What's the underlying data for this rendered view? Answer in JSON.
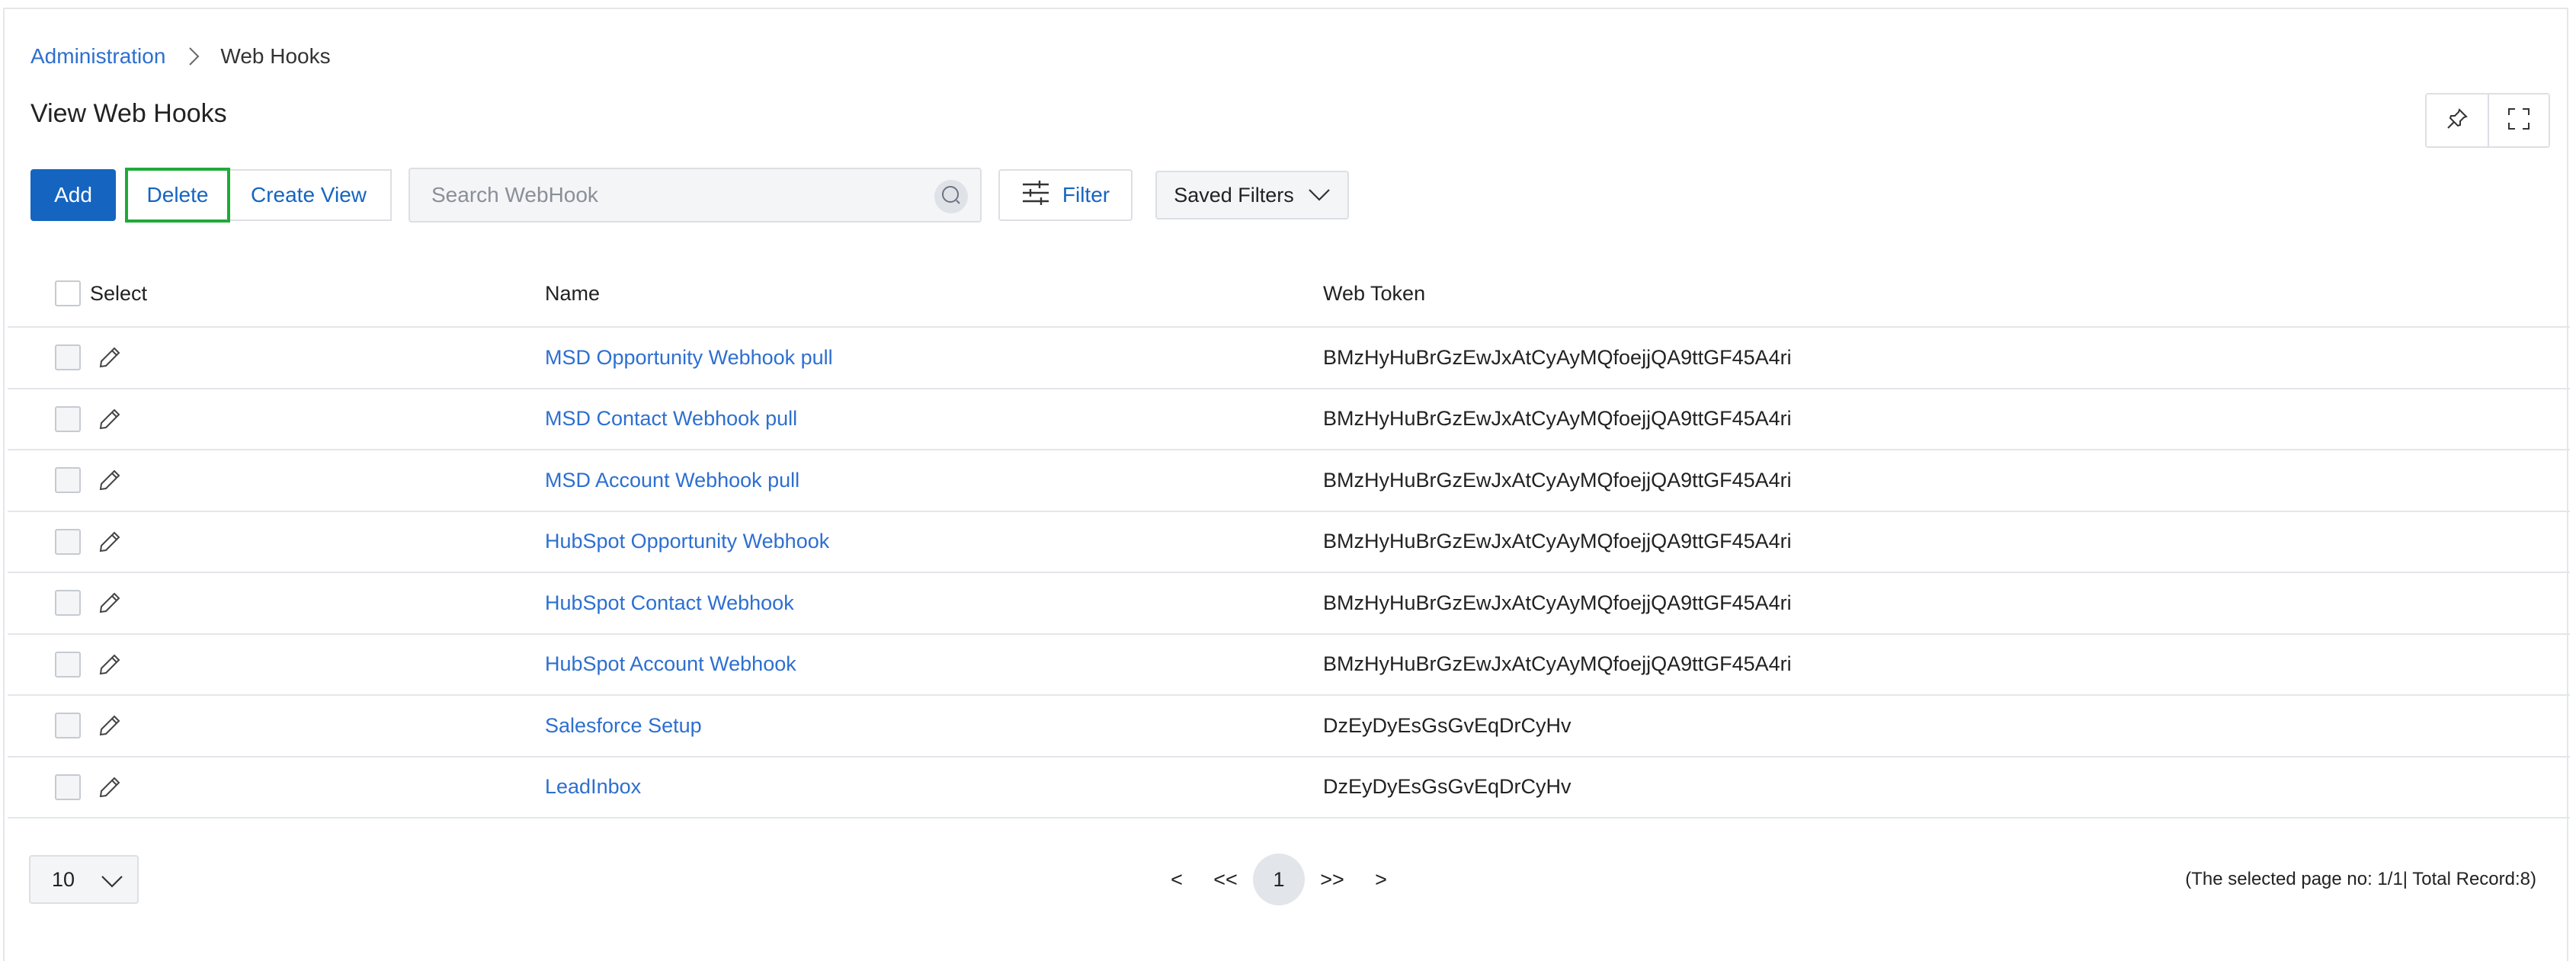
{
  "breadcrumb": {
    "parent": "Administration",
    "current": "Web Hooks"
  },
  "page": {
    "title": "View Web Hooks"
  },
  "toolbar": {
    "add_label": "Add",
    "delete_label": "Delete",
    "create_view_label": "Create View",
    "search_placeholder": "Search WebHook",
    "filter_label": "Filter",
    "saved_filters_label": "Saved Filters"
  },
  "table": {
    "headers": {
      "select": "Select",
      "name": "Name",
      "token": "Web Token"
    },
    "rows": [
      {
        "name": "MSD Opportunity Webhook pull",
        "token": "BMzHyHuBrGzEwJxAtCyAyMQfoejjQA9ttGF45A4ri"
      },
      {
        "name": "MSD Contact Webhook pull",
        "token": "BMzHyHuBrGzEwJxAtCyAyMQfoejjQA9ttGF45A4ri"
      },
      {
        "name": "MSD Account Webhook pull",
        "token": "BMzHyHuBrGzEwJxAtCyAyMQfoejjQA9ttGF45A4ri"
      },
      {
        "name": "HubSpot Opportunity Webhook",
        "token": "BMzHyHuBrGzEwJxAtCyAyMQfoejjQA9ttGF45A4ri"
      },
      {
        "name": "HubSpot Contact Webhook",
        "token": "BMzHyHuBrGzEwJxAtCyAyMQfoejjQA9ttGF45A4ri"
      },
      {
        "name": "HubSpot Account Webhook",
        "token": "BMzHyHuBrGzEwJxAtCyAyMQfoejjQA9ttGF45A4ri"
      },
      {
        "name": "Salesforce Setup",
        "token": "DzEyDyEsGsGvEqDrCyHv"
      },
      {
        "name": "LeadInbox",
        "token": "DzEyDyEsGsGvEqDrCyHv"
      }
    ]
  },
  "pagination": {
    "page_size": "10",
    "prev": "<",
    "first": "<<",
    "current_page": "1",
    "last": ">>",
    "next": ">",
    "info": "(The selected page no: 1/1| Total Record:8)"
  },
  "icons": {
    "breadcrumb_separator": "chevron-right-icon",
    "pin": "pin-icon",
    "fullscreen": "fullscreen-icon",
    "search": "search-icon",
    "filter": "sliders-icon",
    "dropdown": "chevron-down-icon",
    "edit": "pencil-icon"
  },
  "colors": {
    "primary": "#1565c0",
    "link": "#2d6fd0",
    "highlight": "#1faa38"
  }
}
